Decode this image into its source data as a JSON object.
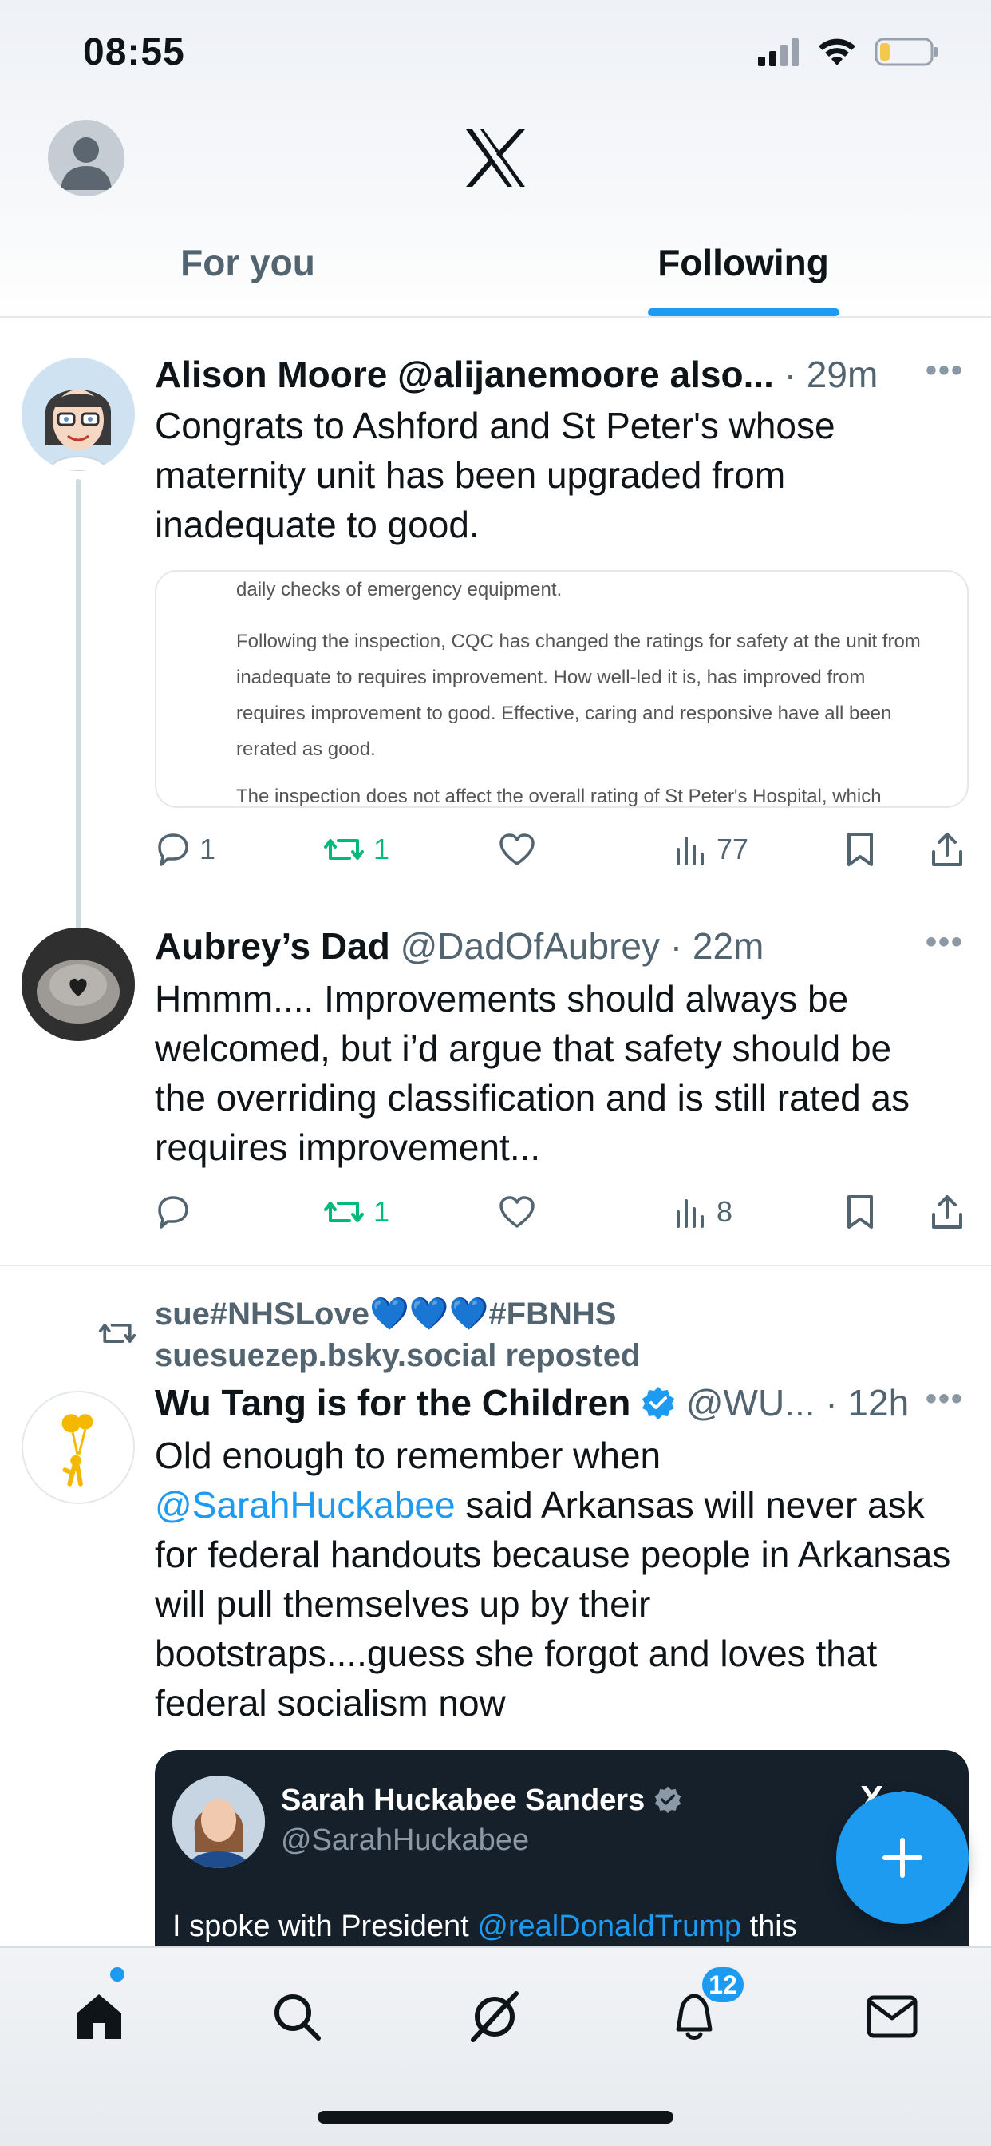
{
  "status_bar": {
    "time": "08:55"
  },
  "header": {
    "logo": "x-logo-icon"
  },
  "tabs": [
    {
      "label": "For you",
      "active": false
    },
    {
      "label": "Following",
      "active": true
    }
  ],
  "tweets": [
    {
      "name": "Alison Moore @alijanemoore also...",
      "meta": "· 29m",
      "text": "Congrats to Ashford and St Peter's whose maternity unit has been upgraded from inadequate to good.",
      "card": {
        "line1": "daily checks of emergency equipment.",
        "para": "Following the inspection, CQC has changed the ratings for safety at the unit from inadequate to requires improvement. How well-led it is, has improved from requires improvement to good. Effective, caring and responsive have all been rerated as good.",
        "line_last": "The inspection does not affect the overall rating of St Peter's Hospital, which"
      },
      "replies": "1",
      "reposts": "1",
      "views": "77"
    },
    {
      "name": "Aubrey’s Dad",
      "handle": "@DadOfAubrey",
      "meta": "· 22m",
      "text": "Hmmm....  Improvements should always be welcomed, but i’d argue that safety should be the overriding classification and is still rated as requires improvement...",
      "reposts": "1",
      "views": "8"
    },
    {
      "repost_by_line1": "sue#NHSLove💙💙💙#FBNHS",
      "repost_by_line2": "suesuezep.bsky.social reposted",
      "name": "Wu Tang is for the Children",
      "handle": "@WU...",
      "meta": "· 12h",
      "text_pre": "Old enough to remember when ",
      "mention": "@SarahHuckabee",
      "text_post": " said Arkansas will never ask for federal handouts because people in Arkansas will pull themselves up by their bootstraps....guess she forgot and loves that federal socialism now",
      "quote": {
        "name": "Sarah Huckabee Sanders",
        "handle": "@SarahHuckabee",
        "logo": "X.c",
        "text_pre": "I spoke with President ",
        "mention": "@realDonaldTrump",
        "text_post": " this"
      }
    }
  ],
  "bottom_nav": {
    "items": [
      "home-icon",
      "search-icon",
      "grok-icon",
      "notifications-icon",
      "messages-icon"
    ],
    "notification_count": "12"
  },
  "colors": {
    "accent": "#1d9bf0",
    "repost": "#00ba7c",
    "text": "#0f1419",
    "muted": "#536471"
  }
}
